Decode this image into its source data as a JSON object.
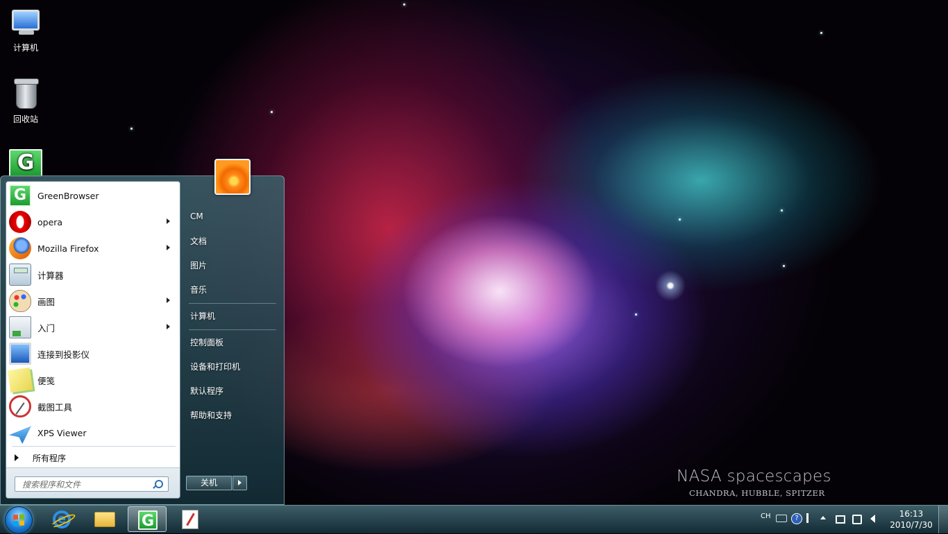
{
  "desktop": {
    "icons": [
      {
        "label": "计算机",
        "icon": "computer-icon"
      },
      {
        "label": "回收站",
        "icon": "recycle-bin-icon"
      },
      {
        "label": "",
        "icon": "greenbrowser-icon"
      }
    ],
    "wallpaper": {
      "title": "NASA spacescapes",
      "subtitle": "CHANDRA, HUBBLE, SPITZER"
    }
  },
  "start_menu": {
    "programs": [
      {
        "label": "GreenBrowser",
        "icon": "greenbrowser-icon",
        "has_submenu": false
      },
      {
        "label": "opera",
        "icon": "opera-icon",
        "has_submenu": true
      },
      {
        "label": "Mozilla Firefox",
        "icon": "firefox-icon",
        "has_submenu": true
      },
      {
        "label": "计算器",
        "icon": "calculator-icon",
        "has_submenu": false
      },
      {
        "label": "画图",
        "icon": "paint-icon",
        "has_submenu": true
      },
      {
        "label": "入门",
        "icon": "getting-started-icon",
        "has_submenu": true
      },
      {
        "label": "连接到投影仪",
        "icon": "projector-icon",
        "has_submenu": false
      },
      {
        "label": "便笺",
        "icon": "sticky-notes-icon",
        "has_submenu": false
      },
      {
        "label": "截图工具",
        "icon": "snipping-tool-icon",
        "has_submenu": false
      },
      {
        "label": "XPS Viewer",
        "icon": "xps-viewer-icon",
        "has_submenu": false
      }
    ],
    "all_programs_label": "所有程序",
    "search_placeholder": "搜索程序和文件",
    "user_picture_icon": "user-flower-icon",
    "right_items": [
      {
        "label": "CM"
      },
      {
        "label": "文档"
      },
      {
        "label": "图片"
      },
      {
        "label": "音乐"
      },
      {
        "label": "计算机"
      },
      {
        "label": "控制面板"
      },
      {
        "label": "设备和打印机"
      },
      {
        "label": "默认程序"
      },
      {
        "label": "帮助和支持"
      }
    ],
    "shutdown_label": "关机"
  },
  "taskbar": {
    "pinned": [
      {
        "icon": "internet-explorer-icon",
        "active": false
      },
      {
        "icon": "windows-explorer-icon",
        "active": false
      },
      {
        "icon": "greenbrowser-icon",
        "active": true
      },
      {
        "icon": "notepad-icon",
        "active": false
      }
    ],
    "tray": {
      "language": "CH",
      "icons": [
        "keyboard-icon",
        "help-icon",
        "ime-options-icon",
        "show-hidden-icons-icon",
        "network-icon",
        "action-center-icon",
        "volume-icon"
      ]
    },
    "clock": {
      "time": "16:13",
      "date": "2010/7/30"
    }
  }
}
